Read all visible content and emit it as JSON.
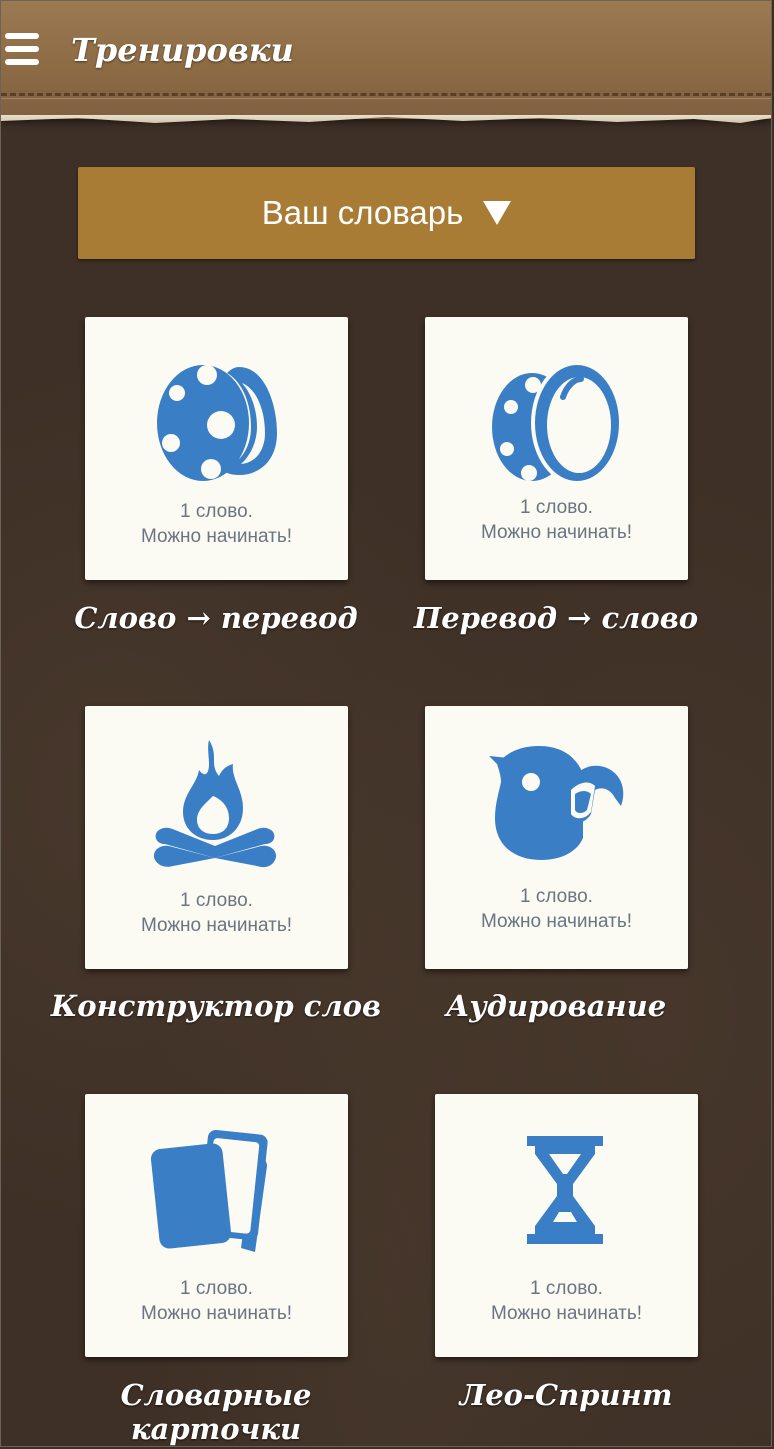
{
  "header": {
    "title": "Тренировки",
    "menu_icon": "hamburger-menu-icon"
  },
  "dictionary_button": {
    "label": "Ваш словарь"
  },
  "colors": {
    "accent": "#a97c36",
    "icon_blue": "#3a7fc6",
    "card_bg": "#fbfaf3"
  },
  "trainings": [
    {
      "icon": "egg-spotted-icon",
      "status_line1": "1 слово.",
      "status_line2": "Можно начинать!",
      "label": "Слово → перевод"
    },
    {
      "icon": "egg-plain-icon",
      "status_line1": "1 слово.",
      "status_line2": "Можно начинать!",
      "label": "Перевод → слово"
    },
    {
      "icon": "campfire-icon",
      "status_line1": "1 слово.",
      "status_line2": "Можно начинать!",
      "label": "Конструктор слов"
    },
    {
      "icon": "parrot-icon",
      "status_line1": "1 слово.",
      "status_line2": "Можно начинать!",
      "label": "Аудирование"
    },
    {
      "icon": "cards-icon",
      "status_line1": "1 слово.",
      "status_line2": "Можно начинать!",
      "label": "Словарные карточки"
    },
    {
      "icon": "hourglass-icon",
      "status_line1": "1 слово.",
      "status_line2": "Можно начинать!",
      "label": "Лео-Спринт"
    }
  ]
}
